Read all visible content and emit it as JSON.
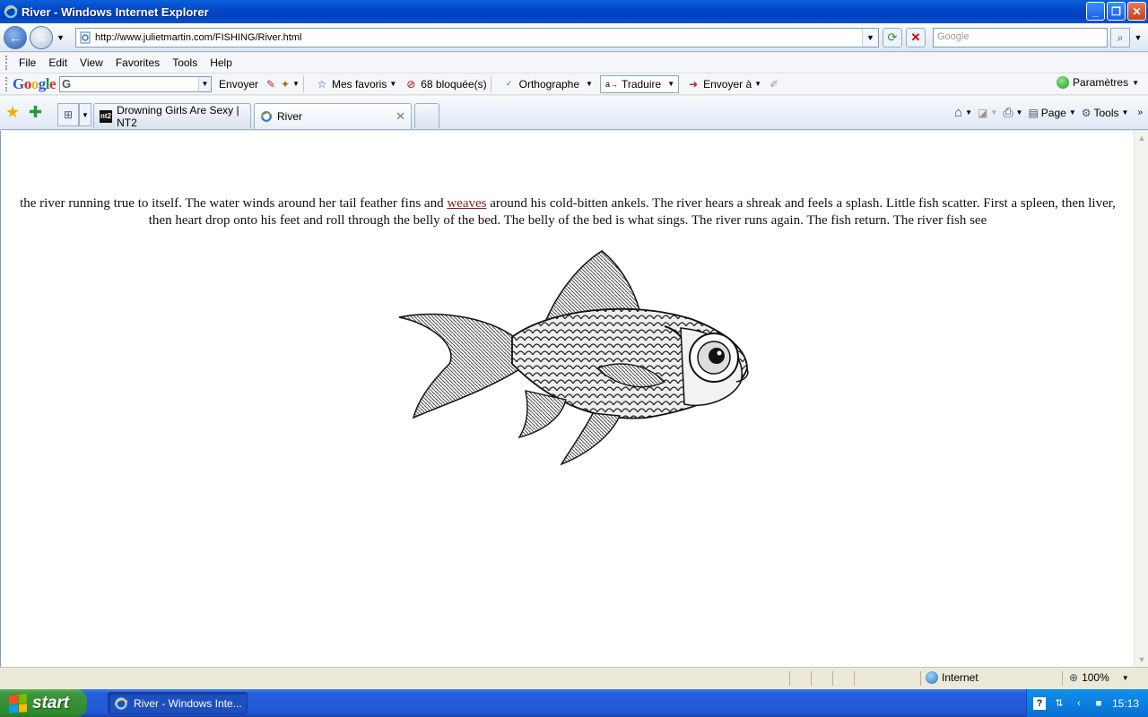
{
  "window": {
    "title": "River - Windows Internet Explorer"
  },
  "address": {
    "url": "http://www.julietmartin.com/FISHING/River.html"
  },
  "search": {
    "placeholder": "Google"
  },
  "menu": {
    "items": [
      "File",
      "Edit",
      "View",
      "Favorites",
      "Tools",
      "Help"
    ]
  },
  "google_toolbar": {
    "send_label": "Envoyer",
    "favorites_label": "Mes favoris",
    "blocked_label": "68 bloquée(s)",
    "spell_label": "Orthographe",
    "translate_label": "Traduire",
    "send_to_label": "Envoyer à",
    "settings_label": "Paramètres"
  },
  "tabs": [
    {
      "label": "Drowning Girls Are Sexy | NT2",
      "favicon": "nt2"
    },
    {
      "label": "River",
      "favicon": "ie-icon"
    }
  ],
  "command_bar": {
    "page_label": "Page",
    "tools_label": "Tools"
  },
  "page": {
    "text_before_link": "the river running true to itself. The water winds around her tail feather fins and",
    "link_text": "weaves",
    "text_after_link": "around his cold-bitten ankels. The river hears a shreak and feels a splash. Little fish scatter. First a spleen, then liver, then heart drop onto his feet and roll through the belly of the bed. The belly of the bed is what sings. The river runs again. The fish return. The river fish see",
    "image": "goldfish-illustration"
  },
  "status": {
    "zone": "Internet",
    "zoom": "100%"
  },
  "taskbar": {
    "start_label": "start",
    "item_label": "River - Windows Inte...",
    "clock": "15:13"
  },
  "colors": {
    "titlebar": "#0348c8",
    "link": "#8a1a1a",
    "taskbar": "#245edc",
    "start": "#3d953d"
  }
}
